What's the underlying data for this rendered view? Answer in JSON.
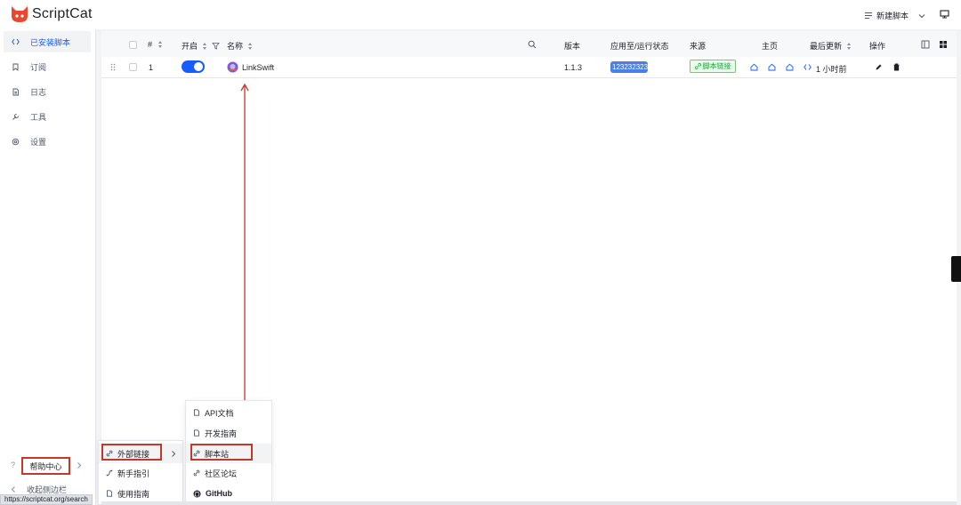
{
  "app": {
    "name": "ScriptCat"
  },
  "header": {
    "new_script_label": "新建脚本"
  },
  "sidebar": {
    "items": [
      {
        "label": "已安装脚本",
        "icon": "code-icon",
        "active": true
      },
      {
        "label": "订阅",
        "icon": "bookmark-icon",
        "active": false
      },
      {
        "label": "日志",
        "icon": "file-icon",
        "active": false
      },
      {
        "label": "工具",
        "icon": "tool-icon",
        "active": false
      },
      {
        "label": "设置",
        "icon": "gear-icon",
        "active": false
      }
    ],
    "help_label": "帮助中心",
    "collapse_label": "收起侧边栏"
  },
  "table": {
    "columns": {
      "index": "#",
      "enabled": "开启",
      "name": "名称",
      "version": "版本",
      "status": "应用至/运行状态",
      "source": "来源",
      "homepage": "主页",
      "updated": "最后更新",
      "actions": "操作"
    },
    "rows": [
      {
        "index": "1",
        "enabled": true,
        "name": "LinkSwift",
        "version": "1.1.3",
        "status": "123232323...",
        "source": "脚本链接",
        "updated": "1 小时前"
      }
    ]
  },
  "menu_external": {
    "items": [
      {
        "label": "外部链接",
        "icon": "link-icon"
      },
      {
        "label": "新手指引",
        "icon": "route-icon"
      },
      {
        "label": "使用指南",
        "icon": "file-icon"
      }
    ]
  },
  "menu_links": {
    "items": [
      {
        "label": "API文档",
        "icon": "file-icon"
      },
      {
        "label": "开发指南",
        "icon": "file-icon"
      },
      {
        "label": "脚本站",
        "icon": "link-icon"
      },
      {
        "label": "社区论坛",
        "icon": "link-icon"
      },
      {
        "label": "GitHub",
        "icon": "github-icon"
      }
    ]
  },
  "statusbar": {
    "url": "https://scriptcat.org/search"
  },
  "colors": {
    "accent": "#165dff",
    "annotation": "#c0392b",
    "source_green": "#00b42a"
  }
}
